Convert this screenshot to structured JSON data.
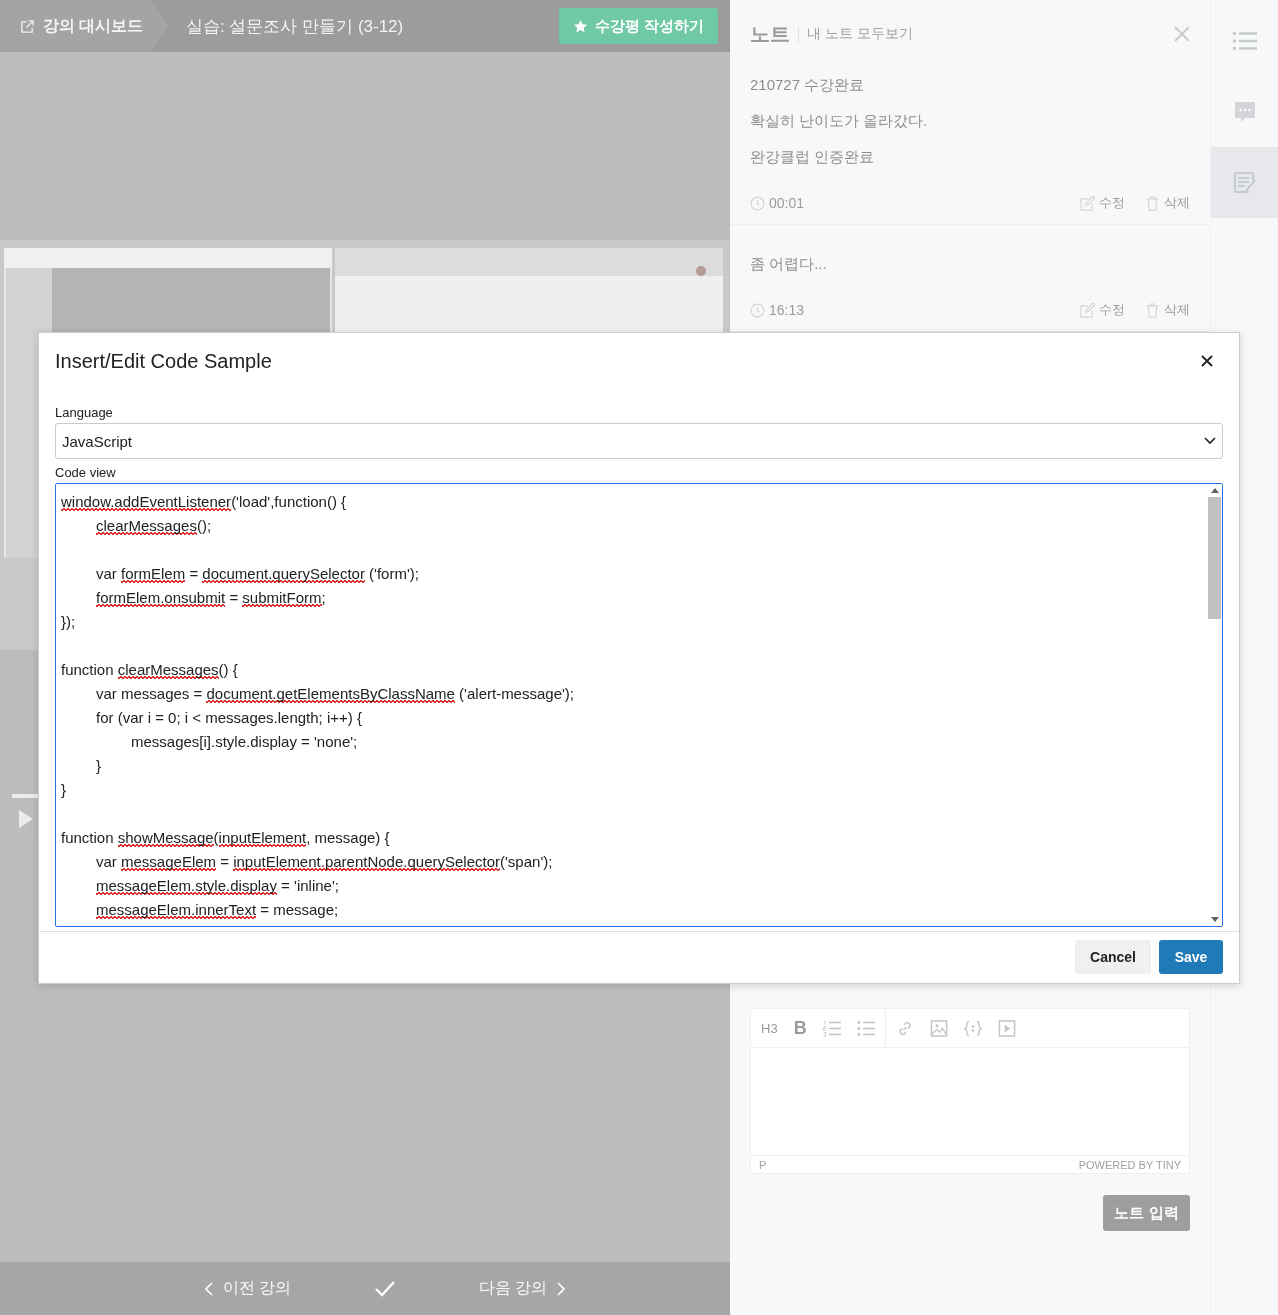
{
  "top_bar": {
    "dashboard_link": "강의 대시보드",
    "lesson_title": "실습: 설문조사 만들기 (3-12)",
    "review_button": "수강평 작성하기"
  },
  "bottom_nav": {
    "previous": "이전 강의",
    "next": "다음 강의",
    "completed": true
  },
  "notes_panel": {
    "title": "노트",
    "view_all_link": "내 노트 모두보기",
    "notes": [
      {
        "lines": [
          "210727 수강완료",
          "확실히 난이도가 올라갔다.",
          "완강클럽 인증완료"
        ],
        "time": "00:01",
        "edit": "수정",
        "delete": "삭제"
      },
      {
        "lines": [
          "좀 어렵다..."
        ],
        "time": "16:13",
        "edit": "수정",
        "delete": "삭제"
      }
    ],
    "editor": {
      "heading_button": "H3",
      "bold_button": "B",
      "status_path": "P",
      "branding": "POWERED BY TINY"
    },
    "submit_button": "노트 입력"
  },
  "side_tabs": [
    {
      "kind": "list",
      "selected": false
    },
    {
      "kind": "chat",
      "selected": false
    },
    {
      "kind": "note",
      "selected": true
    }
  ],
  "dialog": {
    "title": "Insert/Edit Code Sample",
    "language_label": "Language",
    "language_value": "JavaScript",
    "code_label": "Code view",
    "code_lines": [
      {
        "kind": "code",
        "segments": [
          {
            "text": "window.addEventListener",
            "spell_error": true
          },
          {
            "text": "('load',function() {",
            "spell_error": false
          }
        ]
      },
      {
        "kind": "code",
        "segments": [
          {
            "text": "\tclearMessages",
            "spell_error": true
          },
          {
            "text": "();",
            "spell_error": false
          }
        ]
      },
      {
        "kind": "blank"
      },
      {
        "kind": "code",
        "segments": [
          {
            "text": "\tvar ",
            "spell_error": false
          },
          {
            "text": "formElem",
            "spell_error": true
          },
          {
            "text": " = ",
            "spell_error": false
          },
          {
            "text": "document.querySelector",
            "spell_error": true
          },
          {
            "text": " ('form');",
            "spell_error": false
          }
        ]
      },
      {
        "kind": "code",
        "segments": [
          {
            "text": "\tformElem.onsubmit",
            "spell_error": true
          },
          {
            "text": " = ",
            "spell_error": false
          },
          {
            "text": "submitForm",
            "spell_error": true
          },
          {
            "text": ";",
            "spell_error": false
          }
        ]
      },
      {
        "kind": "code",
        "segments": [
          {
            "text": "});",
            "spell_error": false
          }
        ]
      },
      {
        "kind": "blank"
      },
      {
        "kind": "code",
        "segments": [
          {
            "text": "function ",
            "spell_error": false
          },
          {
            "text": "clearMessages",
            "spell_error": true
          },
          {
            "text": "() {",
            "spell_error": false
          }
        ]
      },
      {
        "kind": "code",
        "segments": [
          {
            "text": "\tvar messages = ",
            "spell_error": false
          },
          {
            "text": "document.getElementsByClassName",
            "spell_error": true
          },
          {
            "text": " ('alert-message');",
            "spell_error": false
          }
        ]
      },
      {
        "kind": "code",
        "segments": [
          {
            "text": "\tfor (var i = 0; i < messages.length; i++) {",
            "spell_error": false
          }
        ]
      },
      {
        "kind": "code",
        "segments": [
          {
            "text": "\t\tmessages[i].style.display = 'none';",
            "spell_error": false
          }
        ]
      },
      {
        "kind": "code",
        "segments": [
          {
            "text": "\t}",
            "spell_error": false
          }
        ]
      },
      {
        "kind": "code",
        "segments": [
          {
            "text": "}",
            "spell_error": false
          }
        ]
      },
      {
        "kind": "blank"
      },
      {
        "kind": "code",
        "segments": [
          {
            "text": "function ",
            "spell_error": false
          },
          {
            "text": "showMessage",
            "spell_error": true
          },
          {
            "text": "(",
            "spell_error": false
          },
          {
            "text": "inputElement",
            "spell_error": true
          },
          {
            "text": ", message) {",
            "spell_error": false
          }
        ]
      },
      {
        "kind": "code",
        "segments": [
          {
            "text": "\tvar ",
            "spell_error": false
          },
          {
            "text": "messageElem",
            "spell_error": true
          },
          {
            "text": " = ",
            "spell_error": false
          },
          {
            "text": "inputElement.parentNode.querySelector",
            "spell_error": true
          },
          {
            "text": "('span');",
            "spell_error": false
          }
        ]
      },
      {
        "kind": "code",
        "segments": [
          {
            "text": "\tmessageElem.style.display",
            "spell_error": true
          },
          {
            "text": " = 'inline';",
            "spell_error": false
          }
        ]
      },
      {
        "kind": "code",
        "segments": [
          {
            "text": "\tmessageElem.innerText",
            "spell_error": true
          },
          {
            "text": " = message;",
            "spell_error": false
          }
        ]
      }
    ],
    "cancel_button": "Cancel",
    "save_button": "Save"
  }
}
